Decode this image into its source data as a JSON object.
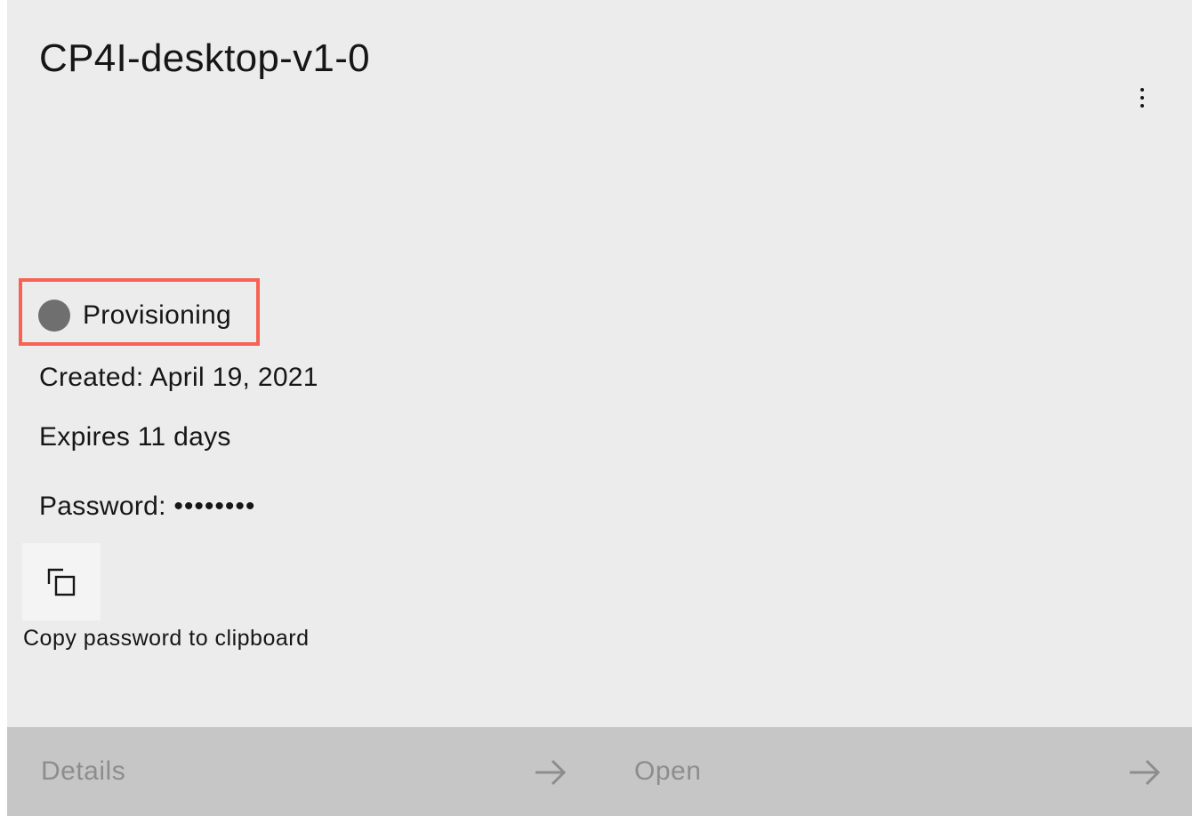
{
  "card": {
    "title": "CP4I-desktop-v1-0",
    "overflow_icon": "overflow-menu-vertical-icon",
    "status": {
      "label": "Provisioning",
      "dot_color": "#6f6f6f",
      "highlight_color": "#f76254"
    },
    "created": "Created: April 19, 2021",
    "expires": "Expires 11 days",
    "password": {
      "label": "Password:",
      "masked_value": "••••••••"
    },
    "copy": {
      "icon": "copy-icon",
      "caption": "Copy password to clipboard"
    },
    "footer": {
      "details_label": "Details",
      "open_label": "Open",
      "arrow_icon": "arrow-right-icon"
    }
  }
}
